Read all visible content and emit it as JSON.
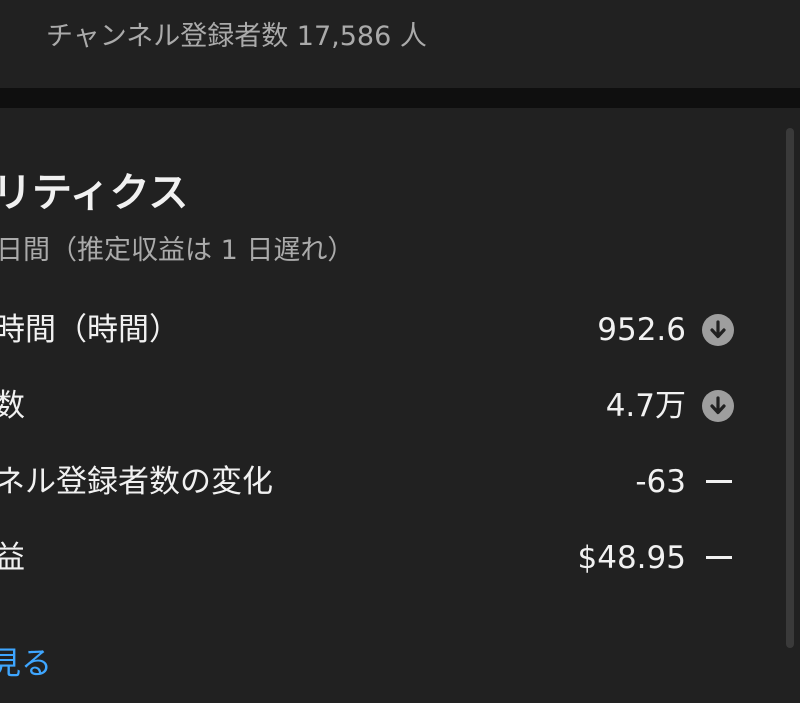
{
  "channel": {
    "subscriber_line": "チャンネル登録者数 17,586 人"
  },
  "analytics": {
    "title": "リティクス",
    "subtitle": "日間（推定収益は 1 日遅れ）",
    "metrics": [
      {
        "label": "時間（時間）",
        "value": "952.6",
        "trend": "down-icon"
      },
      {
        "label": "数",
        "value": "4.7万",
        "trend": "down-icon"
      },
      {
        "label": "ネル登録者数の変化",
        "value": "-63",
        "trend": "dash-icon"
      },
      {
        "label": "益",
        "value": "$48.95",
        "trend": "dash-icon"
      }
    ],
    "see_more": "見る"
  },
  "colors": {
    "background": "#212121",
    "divider": "#0f0f0f",
    "text_primary": "#f1f1f1",
    "text_secondary": "#aaaaaa",
    "link": "#3ea6ff",
    "trend_icon": "#9e9e9e"
  }
}
